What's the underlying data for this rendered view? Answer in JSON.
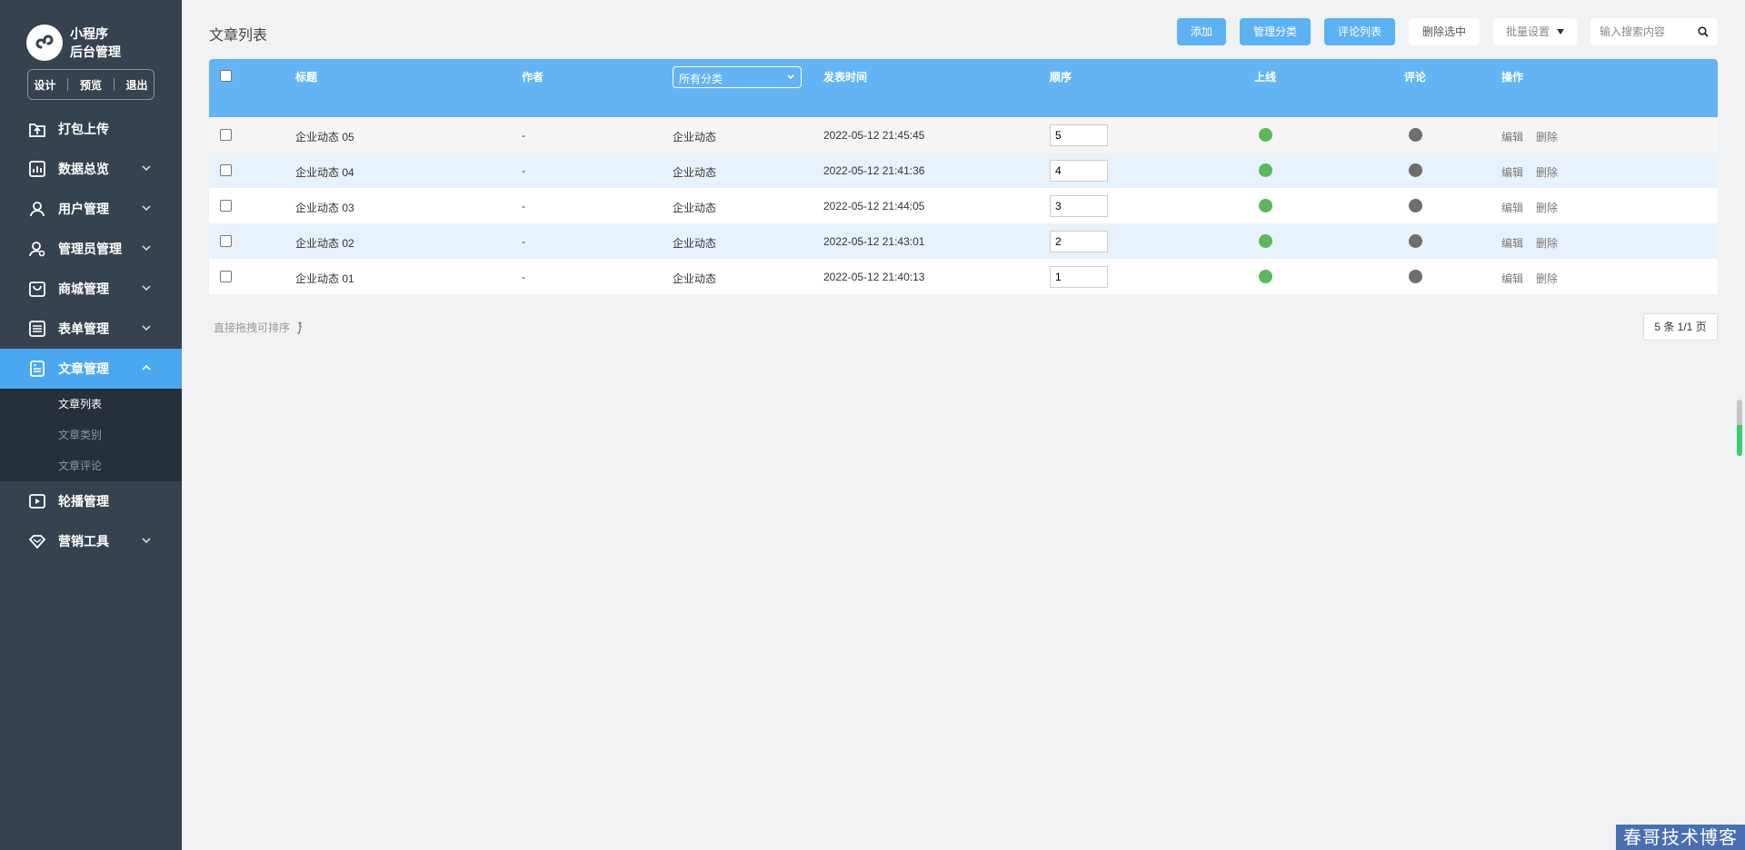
{
  "brand": {
    "line1": "小程序",
    "line2": "后台管理"
  },
  "quick_actions": [
    "设计",
    "预览",
    "退出"
  ],
  "menu": [
    {
      "label": "打包上传",
      "icon": "upload-icon",
      "chevron": false
    },
    {
      "label": "数据总览",
      "icon": "chart-icon",
      "chevron": true
    },
    {
      "label": "用户管理",
      "icon": "user-icon",
      "chevron": true
    },
    {
      "label": "管理员管理",
      "icon": "admin-icon",
      "chevron": true
    },
    {
      "label": "商城管理",
      "icon": "shop-icon",
      "chevron": true
    },
    {
      "label": "表单管理",
      "icon": "form-icon",
      "chevron": true
    },
    {
      "label": "文章管理",
      "icon": "article-icon",
      "chevron": true,
      "active": true
    },
    {
      "label": "轮播管理",
      "icon": "carousel-icon",
      "chevron": false
    },
    {
      "label": "营销工具",
      "icon": "diamond-icon",
      "chevron": true
    }
  ],
  "submenu": [
    "文章列表",
    "文章类别",
    "文章评论"
  ],
  "page_title": "文章列表",
  "toolbar": {
    "add": "添加",
    "manage_category": "管理分类",
    "comment_list": "评论列表",
    "delete_selected": "删除选中",
    "batch_settings": "批量设置",
    "search_placeholder": "输入搜索内容"
  },
  "table": {
    "headers": {
      "title": "标题",
      "author": "作者",
      "category_filter": "所有分类",
      "publish_time": "发表时间",
      "order": "顺序",
      "online": "上线",
      "comment": "评论",
      "actions": "操作"
    },
    "rows": [
      {
        "title": "企业动态 05",
        "author": "-",
        "category": "企业动态",
        "time": "2022-05-12 21:45:45",
        "order": "5",
        "online": true,
        "comment": false,
        "edit": "编辑",
        "delete": "删除"
      },
      {
        "title": "企业动态 04",
        "author": "-",
        "category": "企业动态",
        "time": "2022-05-12 21:41:36",
        "order": "4",
        "online": true,
        "comment": false,
        "edit": "编辑",
        "delete": "删除"
      },
      {
        "title": "企业动态 03",
        "author": "-",
        "category": "企业动态",
        "time": "2022-05-12 21:44:05",
        "order": "3",
        "online": true,
        "comment": false,
        "edit": "编辑",
        "delete": "删除"
      },
      {
        "title": "企业动态 02",
        "author": "-",
        "category": "企业动态",
        "time": "2022-05-12 21:43:01",
        "order": "2",
        "online": true,
        "comment": false,
        "edit": "编辑",
        "delete": "删除"
      },
      {
        "title": "企业动态 01",
        "author": "-",
        "category": "企业动态",
        "time": "2022-05-12 21:40:13",
        "order": "1",
        "online": true,
        "comment": false,
        "edit": "编辑",
        "delete": "删除"
      }
    ]
  },
  "hint": "直接拖拽可排序",
  "pagination": "5 条 1/1 页",
  "watermark": "春哥技术博客",
  "colors": {
    "sidebar": "#36434e",
    "accent": "#4aa8f0",
    "header": "#64b4f4",
    "online": "#5cb85c",
    "offline": "#6e6e6e"
  }
}
